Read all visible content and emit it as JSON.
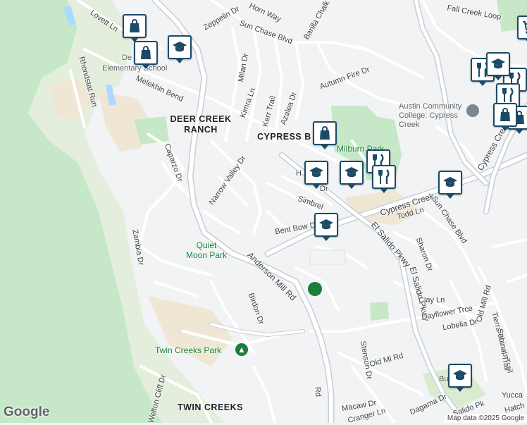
{
  "map": {
    "roads": [
      "Lovett Ln",
      "Zeppelin Dr",
      "Horn Way",
      "Barilla Chalk Ln",
      "Fall Creek Loop",
      "Sun Chase Blvd",
      "Rhondstat Run",
      "Melekhin Bend",
      "Milan Dr",
      "Kimra Ln",
      "Autumn Fire Dr",
      "Kerr Trail",
      "Azalea Dr",
      "Caparzo Dr",
      "Narrow Valley Dr",
      "Simbrel",
      "Bent Bow Dr",
      "Cypress Creek",
      "Todd Ln",
      "Sun Chase Blvd",
      "Cypress Cre",
      "Zambia Dr",
      "Anderson Mill Rd",
      "El Salido Pkwy",
      "El Salido Pkwy",
      "Sharon Dr",
      "Birdon Dr",
      "Clay Ln",
      "Dayflower Trce",
      "Lobelia Dr",
      "Old Mill Rd",
      "Tierra Blanco Trail",
      "Sabinal Trail",
      "Yucca",
      "Stenson Dr",
      "Old Ml Rd",
      "Welton Cliff Dr",
      "Macaw Dr",
      "Cranger Ln",
      "Dagama Dr",
      "Salido Pk",
      "Hatch",
      "Rd",
      "Bu",
      "H",
      "Dr"
    ],
    "areas": [
      "DEER CREEK RANCH",
      "CYPRESS B",
      "TWIN CREEKS"
    ],
    "parks": [
      "Milburn Park",
      "Quiet Moon Park",
      "Twin Creeks Park"
    ],
    "pois": [
      "Austin Community College: Cypress Creek",
      "De",
      "Elementary School"
    ],
    "markers": [
      "shopping",
      "school",
      "shopping",
      "school",
      "shopping",
      "school",
      "school",
      "restaurant",
      "restaurant",
      "school",
      "school",
      "restaurant",
      "restaurant",
      "restaurant",
      "shopping",
      "shopping",
      "school",
      "school"
    ],
    "colors": {
      "background": "#f1f3f4",
      "road": "#ffffff",
      "road_casing": "#d5d9dd",
      "highway": "#c8ced4",
      "park": "#c6e8c8",
      "brown_area": "#efe7d4",
      "marker_border": "#1c4b66",
      "park_text": "#188038"
    }
  },
  "branding": {
    "logo": "Google",
    "attribution": "Map data ©2025 Google"
  }
}
